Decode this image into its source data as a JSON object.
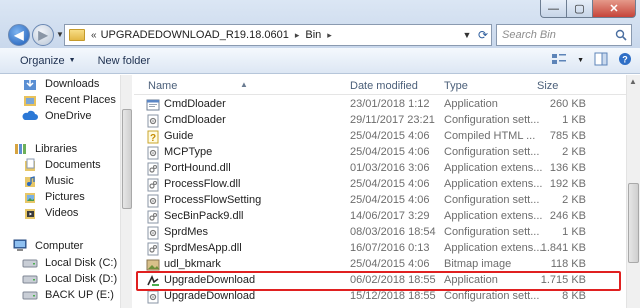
{
  "address": {
    "chevron": "«",
    "segments": [
      "UPGRADEDOWNLOAD_R19.18.0601",
      "Bin"
    ],
    "separator": "▸"
  },
  "search": {
    "placeholder": "Search Bin"
  },
  "toolbar": {
    "organize_label": "Organize",
    "new_folder_label": "New folder"
  },
  "window_controls": {
    "minimize": "—",
    "maximize": "▢",
    "close": "✕"
  },
  "sidebar": {
    "favorites": [
      {
        "label": "Downloads",
        "icon": "downloads-icon"
      },
      {
        "label": "Recent Places",
        "icon": "recent-places-icon"
      },
      {
        "label": "OneDrive",
        "icon": "onedrive-icon"
      }
    ],
    "libraries_label": "Libraries",
    "libraries": [
      {
        "label": "Documents",
        "icon": "documents-icon"
      },
      {
        "label": "Music",
        "icon": "music-icon"
      },
      {
        "label": "Pictures",
        "icon": "pictures-icon"
      },
      {
        "label": "Videos",
        "icon": "videos-icon"
      }
    ],
    "computer_label": "Computer",
    "drives": [
      {
        "label": "Local Disk (C:)",
        "icon": "disk-icon"
      },
      {
        "label": "Local Disk (D:)",
        "icon": "disk-icon"
      },
      {
        "label": "BACK UP (E:)",
        "icon": "disk-icon"
      }
    ]
  },
  "columns": {
    "name": "Name",
    "date": "Date modified",
    "type": "Type",
    "size": "Size"
  },
  "files": [
    {
      "name": "CmdDloader",
      "date": "23/01/2018 1:12",
      "type": "Application",
      "size": "260 KB",
      "icon": "application-icon"
    },
    {
      "name": "CmdDloader",
      "date": "29/11/2017 23:21",
      "type": "Configuration sett...",
      "size": "1 KB",
      "icon": "config-file-icon"
    },
    {
      "name": "Guide",
      "date": "25/04/2015 4:06",
      "type": "Compiled HTML ...",
      "size": "785 KB",
      "icon": "help-file-icon"
    },
    {
      "name": "MCPType",
      "date": "25/04/2015 4:06",
      "type": "Configuration sett...",
      "size": "2 KB",
      "icon": "config-file-icon"
    },
    {
      "name": "PortHound.dll",
      "date": "01/03/2016 3:06",
      "type": "Application extens...",
      "size": "136 KB",
      "icon": "dll-icon"
    },
    {
      "name": "ProcessFlow.dll",
      "date": "25/04/2015 4:06",
      "type": "Application extens...",
      "size": "192 KB",
      "icon": "dll-icon"
    },
    {
      "name": "ProcessFlowSetting",
      "date": "25/04/2015 4:06",
      "type": "Configuration sett...",
      "size": "2 KB",
      "icon": "config-file-icon"
    },
    {
      "name": "SecBinPack9.dll",
      "date": "14/06/2017 3:29",
      "type": "Application extens...",
      "size": "246 KB",
      "icon": "dll-icon"
    },
    {
      "name": "SprdMes",
      "date": "08/03/2016 18:54",
      "type": "Configuration sett...",
      "size": "1 KB",
      "icon": "config-file-icon"
    },
    {
      "name": "SprdMesApp.dll",
      "date": "16/07/2016 0:13",
      "type": "Application extens...",
      "size": "1.841 KB",
      "icon": "dll-icon"
    },
    {
      "name": "udl_bkmark",
      "date": "25/04/2015 4:06",
      "type": "Bitmap image",
      "size": "118 KB",
      "icon": "bitmap-icon"
    },
    {
      "name": "UpgradeDownload",
      "date": "06/02/2018 18:55",
      "type": "Application",
      "size": "1.715 KB",
      "icon": "upgrade-app-icon"
    },
    {
      "name": "UpgradeDownload",
      "date": "15/12/2018 18:55",
      "type": "Configuration sett...",
      "size": "8 KB",
      "icon": "config-file-icon"
    }
  ],
  "colors": {
    "highlight": "#e02020",
    "accent": "#1c5bb6"
  }
}
